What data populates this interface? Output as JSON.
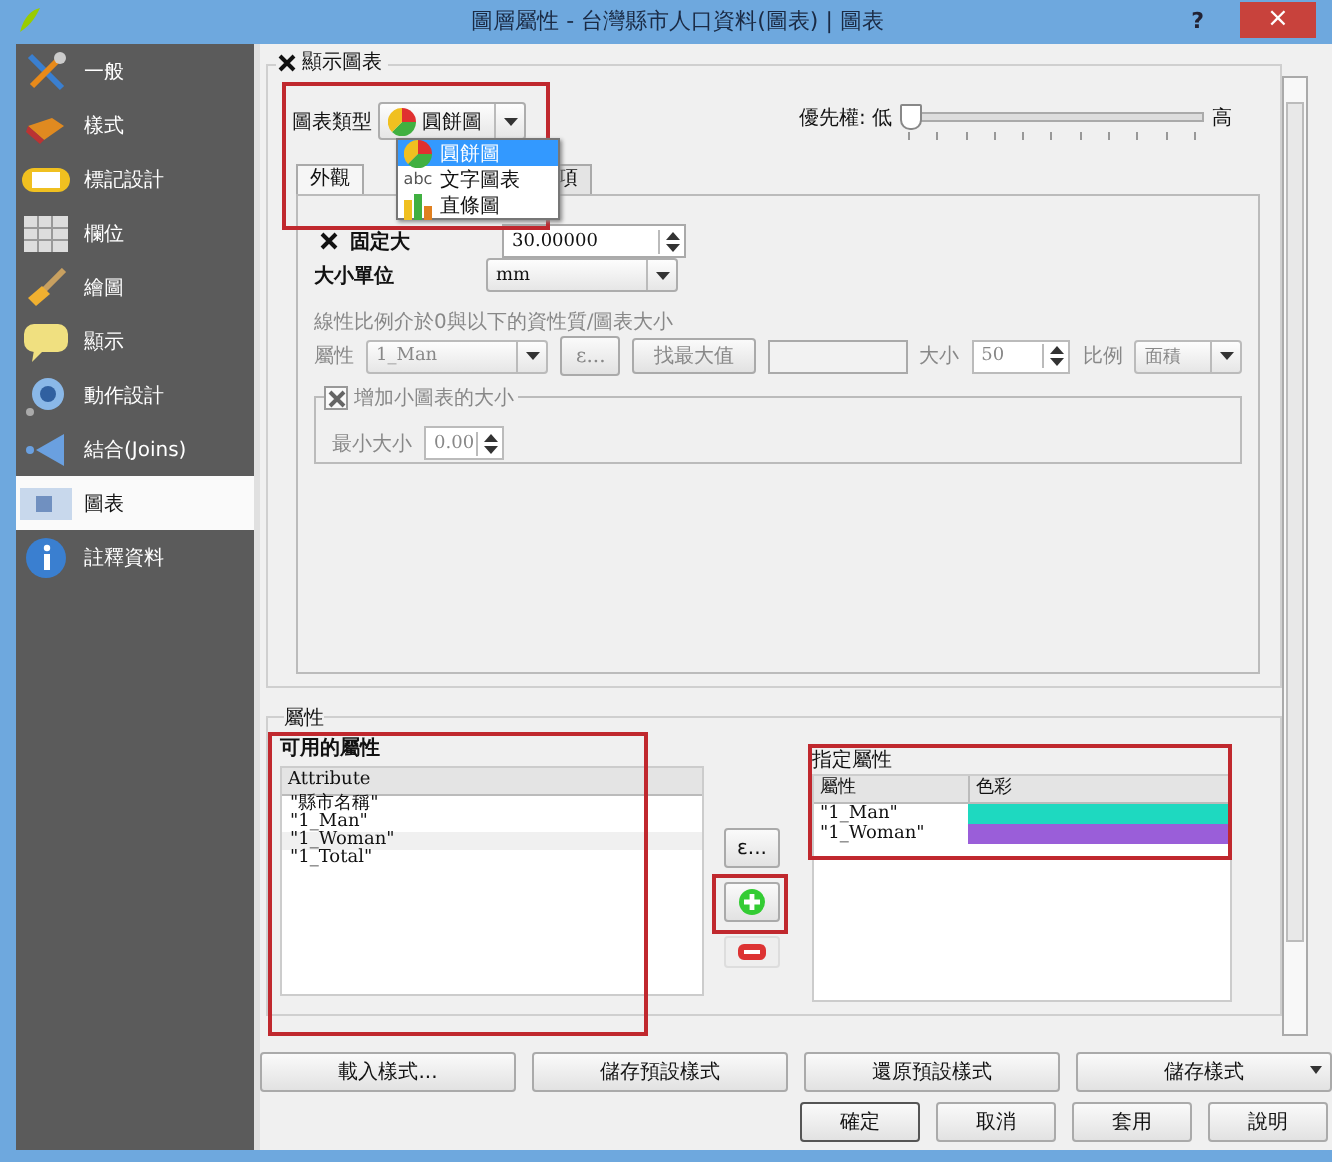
{
  "window": {
    "title": "圖層屬性 - 台灣縣市人口資料(圖表) | 圖表",
    "help": "?",
    "close": "×"
  },
  "sidebar": {
    "items": [
      {
        "label": "一般",
        "selected": false
      },
      {
        "label": "樣式",
        "selected": false
      },
      {
        "label": "標記設計",
        "selected": false
      },
      {
        "label": "欄位",
        "selected": false
      },
      {
        "label": "繪圖",
        "selected": false
      },
      {
        "label": "顯示",
        "selected": false
      },
      {
        "label": "動作設計",
        "selected": false
      },
      {
        "label": "結合(Joins)",
        "selected": false
      },
      {
        "label": "圖表",
        "selected": true
      },
      {
        "label": "註釋資料",
        "selected": false
      }
    ]
  },
  "show_diagram": {
    "label": "顯示圖表",
    "checked": true
  },
  "chart_type": {
    "label": "圖表類型",
    "value": "圓餅圖",
    "options": [
      {
        "label": "圓餅圖",
        "selected": true
      },
      {
        "label": "文字圖表",
        "icon_text": "abc",
        "selected": false
      },
      {
        "label": "直條圖",
        "selected": false
      }
    ]
  },
  "priority": {
    "label": "優先權: 低",
    "high_label": "高",
    "level": 0
  },
  "tabs": [
    {
      "label": "外觀",
      "selected": true
    },
    {
      "label": "項",
      "selected": false
    }
  ],
  "fixed_size": {
    "label": "固定大",
    "checked": true,
    "value": "30.00000"
  },
  "size_unit": {
    "label": "大小單位",
    "value": "mm"
  },
  "scaling": {
    "caption": "線性比例介於0與以下的資性質/圖表大小",
    "attribute_label": "屬性",
    "attribute_value": "1_Man",
    "expression_button": "ε...",
    "find_max_button": "找最大值",
    "size_label": "大小",
    "size_value": "50",
    "scale_label": "比例",
    "scale_value": "面積"
  },
  "increase_small": {
    "label": "增加小圖表的大小",
    "checked": true,
    "min_label": "最小大小",
    "min_value": "0.00"
  },
  "attributes": {
    "title": "屬性",
    "available_title": "可用的屬性",
    "available_column": "Attribute",
    "available_items": [
      {
        "label": "\"縣市名稱\"",
        "selected": false
      },
      {
        "label": "\"1_Man\"",
        "selected": false
      },
      {
        "label": "\"1_Woman\"",
        "selected": true
      },
      {
        "label": "\"1_Total\"",
        "selected": false
      }
    ],
    "expression_button": "ε...",
    "assigned_title": "指定屬性",
    "assigned_columns": [
      "屬性",
      "色彩"
    ],
    "assigned_rows": [
      {
        "attribute": "\"1_Man\"",
        "color": "#1ed9c0"
      },
      {
        "attribute": "\"1_Woman\"",
        "color": "#9a5ed9"
      }
    ]
  },
  "style_buttons": [
    "載入樣式...",
    "儲存預設樣式",
    "還原預設樣式",
    "儲存樣式"
  ],
  "dialog_buttons": [
    "確定",
    "取消",
    "套用",
    "說明"
  ]
}
